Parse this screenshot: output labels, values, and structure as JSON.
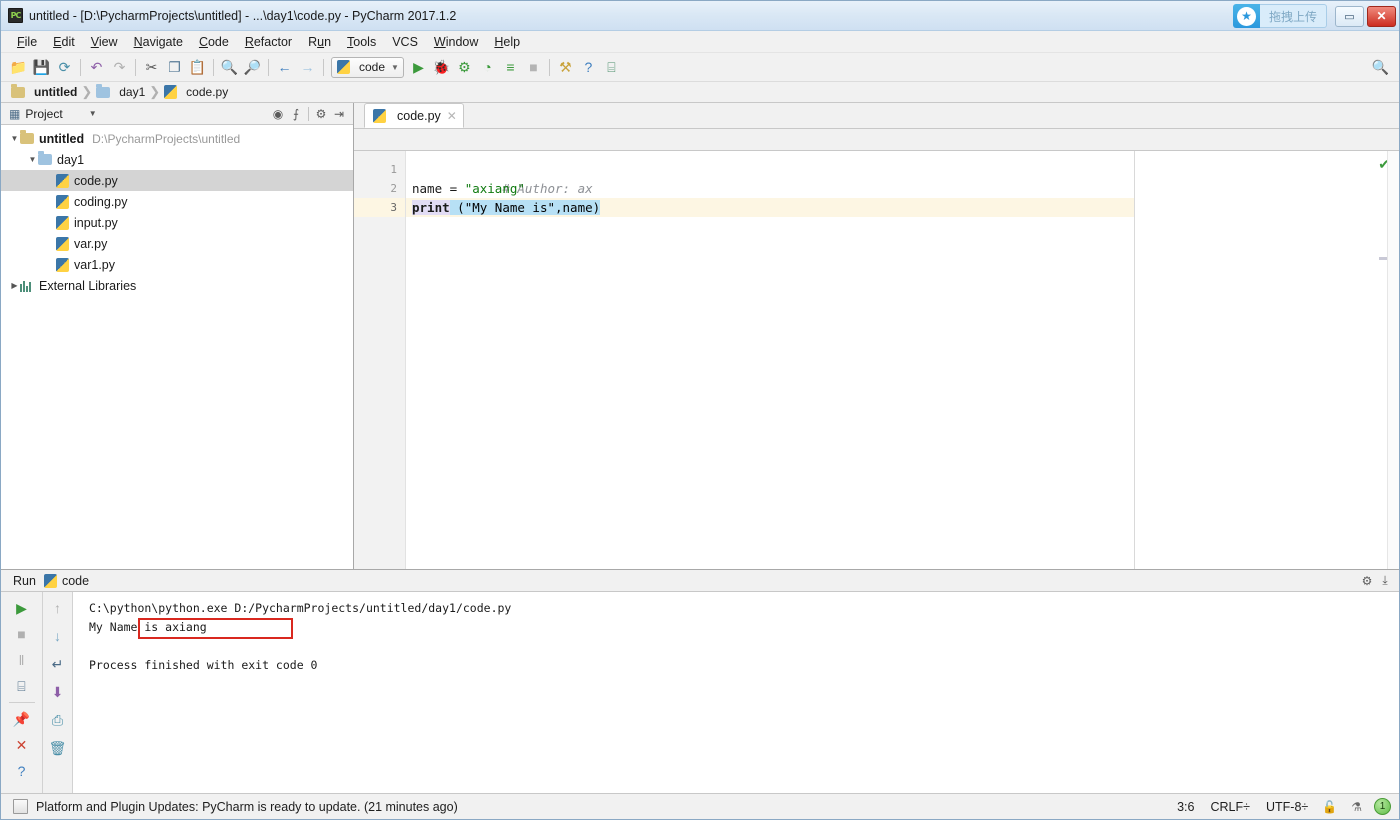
{
  "window": {
    "title": "untitled - [D:\\PycharmProjects\\untitled] - ...\\day1\\code.py - PyCharm 2017.1.2",
    "app_icon": "PC",
    "upload_badge_text": "拖拽上传",
    "upload_logo_icon": "cloud-upload-icon",
    "minimize_label": "▭",
    "close_label": "✕"
  },
  "menubar": {
    "items": [
      {
        "label": "File",
        "accel": "F"
      },
      {
        "label": "Edit",
        "accel": "E"
      },
      {
        "label": "View",
        "accel": "V"
      },
      {
        "label": "Navigate",
        "accel": "N"
      },
      {
        "label": "Code",
        "accel": "C"
      },
      {
        "label": "Refactor",
        "accel": "R"
      },
      {
        "label": "Run",
        "accel": "u"
      },
      {
        "label": "Tools",
        "accel": "T"
      },
      {
        "label": "VCS",
        "accel": ""
      },
      {
        "label": "Window",
        "accel": "W"
      },
      {
        "label": "Help",
        "accel": "H"
      }
    ]
  },
  "toolbar": {
    "icons": [
      {
        "name": "open-folder-icon",
        "glyph": "📁",
        "color": "#d9a93c"
      },
      {
        "name": "save-all-icon",
        "glyph": "💾",
        "color": "#5a7d99"
      },
      {
        "name": "sync-icon",
        "glyph": "⟳",
        "color": "#4a8fa8"
      },
      {
        "name": "undo-icon",
        "glyph": "↶",
        "color": "#8e5fa8"
      },
      {
        "name": "redo-icon",
        "glyph": "↷",
        "color": "#b0b0b0"
      },
      {
        "name": "cut-icon",
        "glyph": "✂",
        "color": "#5a5a5a"
      },
      {
        "name": "copy-icon",
        "glyph": "❐",
        "color": "#5a7d99"
      },
      {
        "name": "paste-icon",
        "glyph": "📋",
        "color": "#c47a3c"
      },
      {
        "name": "find-icon",
        "glyph": "🔍",
        "color": "#4a6a86"
      },
      {
        "name": "replace-icon",
        "glyph": "🔎",
        "color": "#4a6a86"
      },
      {
        "name": "back-icon",
        "glyph": "←",
        "color": "#3f7fbf"
      },
      {
        "name": "forward-icon",
        "glyph": "→",
        "color": "#9fc3e0"
      }
    ],
    "run_config": {
      "name": "code",
      "icon": "python-file-icon",
      "caret": "▼"
    },
    "run_icons": [
      {
        "name": "run-button",
        "glyph": "▶",
        "color": "#3c9a3c"
      },
      {
        "name": "debug-button",
        "glyph": "🐞",
        "color": "#3c9a3c"
      },
      {
        "name": "run-coverage-button",
        "glyph": "⚙",
        "color": "#3c9a3c"
      },
      {
        "name": "profile-button",
        "glyph": "◔",
        "color": "#3c9a3c"
      },
      {
        "name": "step-button",
        "glyph": "≡",
        "color": "#3c9a3c"
      },
      {
        "name": "stop-button",
        "glyph": "■",
        "color": "#b4b4b4"
      }
    ],
    "tail_icons": [
      {
        "name": "settings-icon",
        "glyph": "⚒",
        "color": "#c9a33c"
      },
      {
        "name": "help-icon",
        "glyph": "?",
        "color": "#3f7fbf"
      },
      {
        "name": "database-icon",
        "glyph": "⌸",
        "color": "#4a8f6a"
      }
    ],
    "search_icon": "search-everywhere-icon"
  },
  "breadcrumb": {
    "items": [
      {
        "label": "untitled",
        "icon": "module-icon",
        "bold": true
      },
      {
        "label": "day1",
        "icon": "folder-icon",
        "bold": false
      },
      {
        "label": "code.py",
        "icon": "python-file-icon",
        "bold": false
      }
    ],
    "separator": "❯"
  },
  "project_panel": {
    "title": "Project",
    "panel_icon": "project-view-icon",
    "caret": "▼",
    "header_icons": [
      {
        "name": "scroll-from-source-icon",
        "glyph": "⊙"
      },
      {
        "name": "collapse-all-icon",
        "glyph": "⨍"
      },
      {
        "name": "settings-gear-icon",
        "glyph": "⚙"
      },
      {
        "name": "hide-panel-icon",
        "glyph": "⇥"
      }
    ],
    "tree": [
      {
        "label": "untitled",
        "path": "D:\\PycharmProjects\\untitled",
        "icon": "folder-icon",
        "arrow": "▼",
        "indent": 0,
        "bold": true,
        "selected": false
      },
      {
        "label": "day1",
        "path": "",
        "icon": "folder-blue-icon",
        "arrow": "▼",
        "indent": 1,
        "bold": false,
        "selected": false
      },
      {
        "label": "code.py",
        "path": "",
        "icon": "python-file-icon",
        "arrow": "",
        "indent": 2,
        "bold": false,
        "selected": true
      },
      {
        "label": "coding.py",
        "path": "",
        "icon": "python-file-icon",
        "arrow": "",
        "indent": 2,
        "bold": false,
        "selected": false
      },
      {
        "label": "input.py",
        "path": "",
        "icon": "python-file-icon",
        "arrow": "",
        "indent": 2,
        "bold": false,
        "selected": false
      },
      {
        "label": "var.py",
        "path": "",
        "icon": "python-file-icon",
        "arrow": "",
        "indent": 2,
        "bold": false,
        "selected": false
      },
      {
        "label": "var1.py",
        "path": "",
        "icon": "python-file-icon",
        "arrow": "",
        "indent": 2,
        "bold": false,
        "selected": false
      },
      {
        "label": "External Libraries",
        "path": "",
        "icon": "library-icon",
        "arrow": "▶",
        "indent": 0,
        "bold": false,
        "selected": false
      }
    ]
  },
  "editor": {
    "tab": {
      "label": "code.py",
      "icon": "python-file-icon",
      "close": "✕"
    },
    "lines": [
      {
        "number": "1",
        "current": false
      },
      {
        "number": "2",
        "current": false
      },
      {
        "number": "3",
        "current": true
      }
    ],
    "code": {
      "line1_comment": "# Author: ax",
      "line2_var": "name",
      "line2_op": " = ",
      "line2_str": "\"axiang\"",
      "line3_kw": "print",
      "line3_rest": " (\"My Name is\",name)"
    },
    "inspection_status_icon": "inspection-ok-check-icon",
    "inspection_glyph": "✔"
  },
  "run_panel": {
    "header_label": "Run",
    "config_name": "code",
    "config_icon": "python-file-icon",
    "header_icons": [
      {
        "name": "run-settings-gear-icon",
        "glyph": "⚙"
      },
      {
        "name": "hide-run-panel-icon",
        "glyph": "⤓"
      }
    ],
    "left_tools": [
      {
        "name": "rerun-button",
        "glyph": "▶",
        "color": "#3c9a3c"
      },
      {
        "name": "stop-button",
        "glyph": "■",
        "color": "#b0b0b0"
      },
      {
        "name": "pause-button",
        "glyph": "‖",
        "color": "#b0b0b0"
      },
      {
        "name": "toggle-console-button",
        "glyph": "⌸",
        "color": "#4a6a86"
      },
      {
        "name": "pin-tab-button",
        "glyph": "📌",
        "color": "#8e5fa8"
      },
      {
        "name": "close-button",
        "glyph": "✕",
        "color": "#cc4433"
      },
      {
        "name": "help-button",
        "glyph": "?",
        "color": "#3f7fbf"
      }
    ],
    "right_tools": [
      {
        "name": "up-arrow-button",
        "glyph": "↑",
        "color": "#b0b0b0"
      },
      {
        "name": "down-arrow-button",
        "glyph": "↓",
        "color": "#7aa8c4"
      },
      {
        "name": "soft-wrap-button",
        "glyph": "↵",
        "color": "#4a6a86"
      },
      {
        "name": "scroll-to-end-button",
        "glyph": "⬇",
        "color": "#8e5fa8"
      },
      {
        "name": "print-button",
        "glyph": "⎙",
        "color": "#4a8fa8"
      },
      {
        "name": "clear-all-button",
        "glyph": "🗑",
        "color": "#4a8fa8"
      }
    ],
    "console": {
      "command_line": "C:\\python\\python.exe D:/PycharmProjects/untitled/day1/code.py",
      "output_line": "My Name is axiang",
      "exit_line": "Process finished with exit code 0",
      "highlight_color": "#d9281f"
    }
  },
  "statusbar": {
    "message": "Platform and Plugin Updates: PyCharm is ready to update. (21 minutes ago)",
    "message_icon": "event-log-icon",
    "caret_position": "3:6",
    "line_separator": "CRLF÷",
    "encoding": "UTF-8÷",
    "lock_icon": "unlocked-icon",
    "lock_glyph": "🔓",
    "hector_icon": "inspection-level-icon",
    "hector_glyph": "⚗",
    "badge_count": "1"
  }
}
